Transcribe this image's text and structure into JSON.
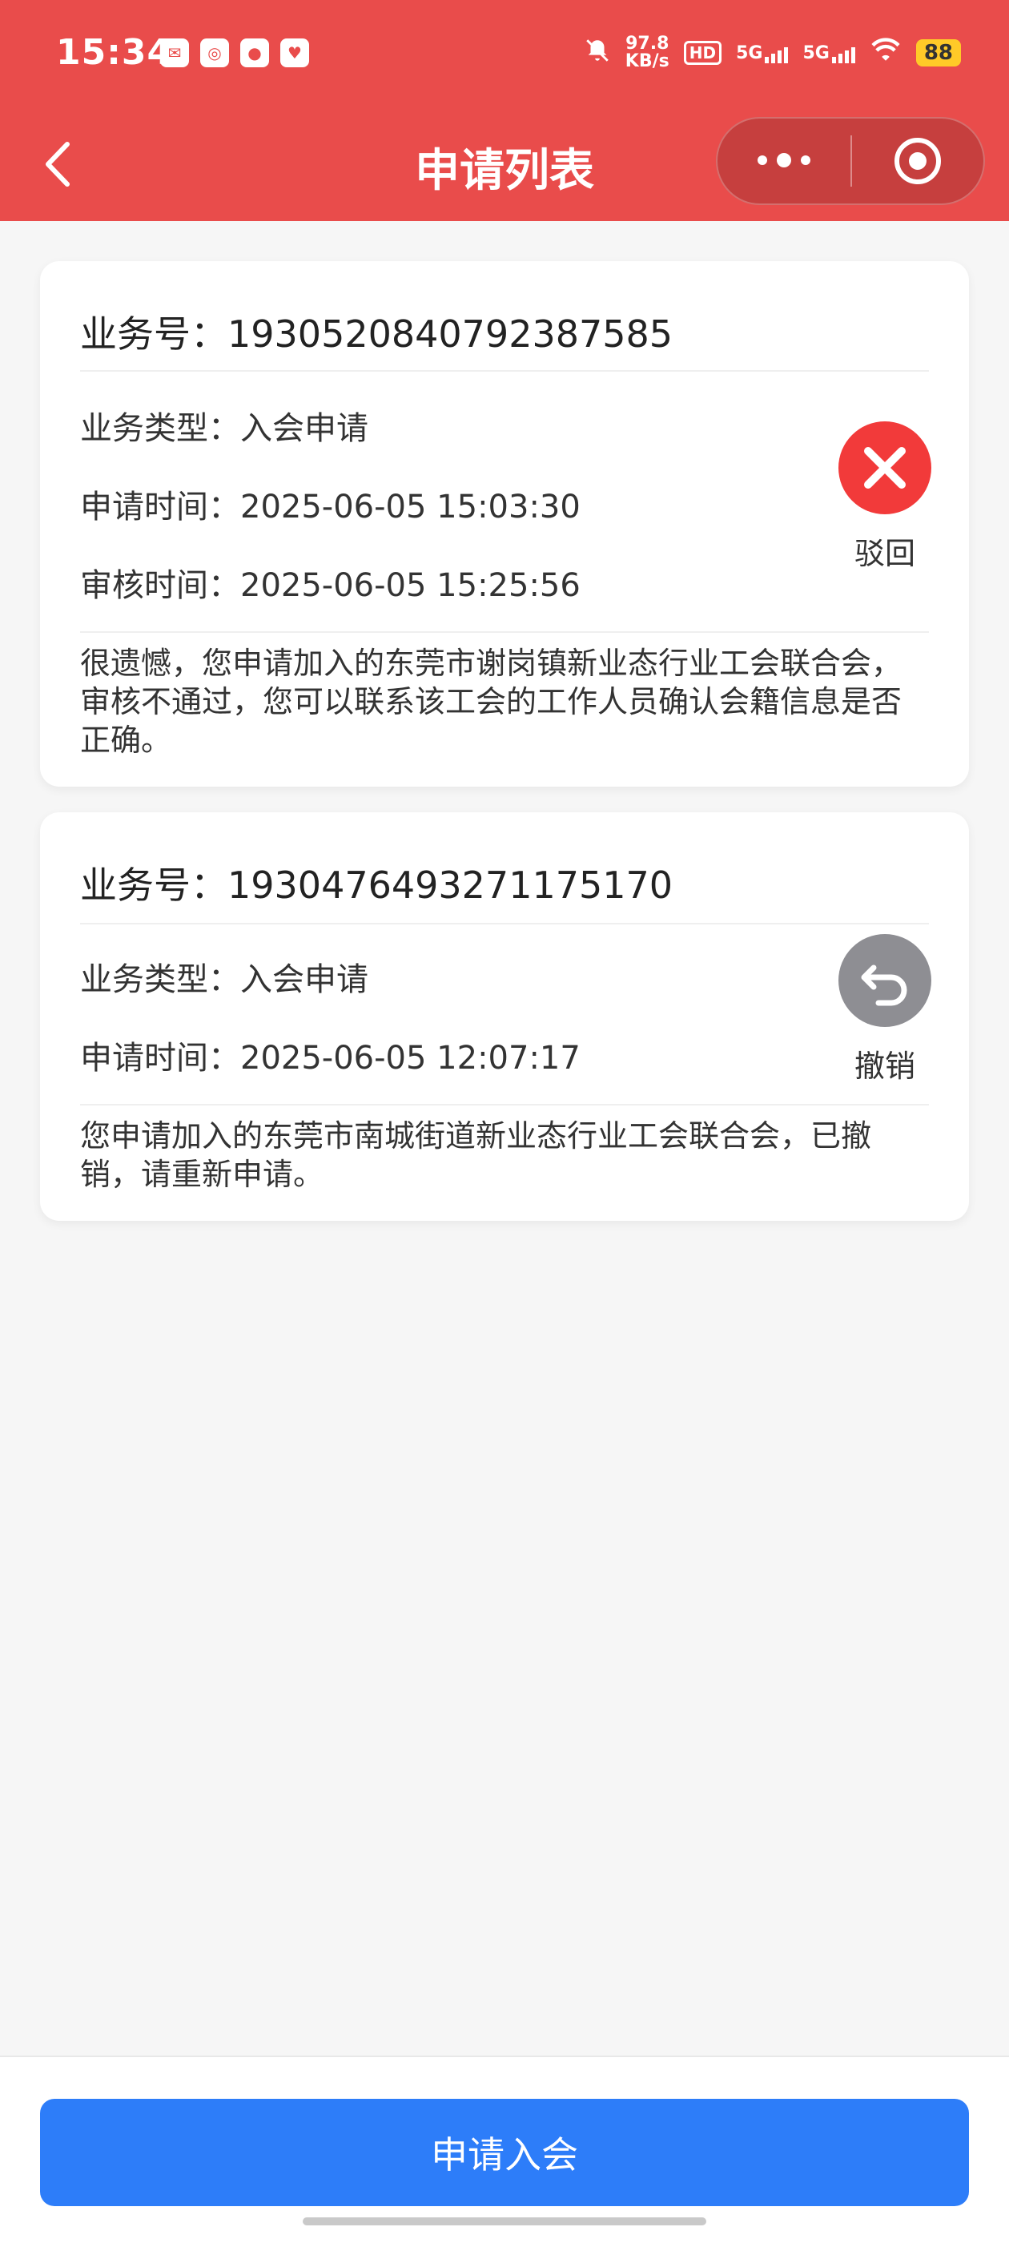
{
  "status_bar": {
    "time": "15:34",
    "net_speed_top": "97.8",
    "net_speed_bottom": "KB/s",
    "hd": "HD",
    "sig1": "5G",
    "sig2": "5G",
    "battery": "88"
  },
  "header": {
    "title": "申请列表",
    "accent": "#e94c4b"
  },
  "applications": [
    {
      "biz_no": "业务号：1930520840792387585",
      "type": "业务类型：入会申请",
      "apply_time": "申请时间：2025-06-05 15:03:30",
      "review_time": "审核时间：2025-06-05 15:25:56",
      "note": "很遗憾，您申请加入的东莞市谢岗镇新业态行业工会联合会，审核不通过，您可以联系该工会的工作人员确认会籍信息是否正确。",
      "status_label": "驳回",
      "status_color": "#f23a3a"
    },
    {
      "biz_no": "业务号：1930476493271175170",
      "type": "业务类型：入会申请",
      "apply_time": "申请时间：2025-06-05 12:07:17",
      "note": "您申请加入的东莞市南城街道新业态行业工会联合会，已撤销，请重新申请。",
      "status_label": "撤销",
      "status_color": "#8e8e93"
    }
  ],
  "footer": {
    "apply_label": "申请入会",
    "button_color": "#2d7df9"
  }
}
